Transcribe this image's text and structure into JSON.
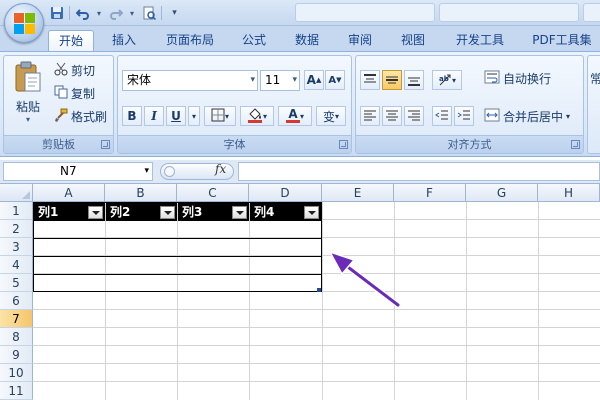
{
  "window": {
    "quick_access": [
      "save-icon",
      "undo-icon",
      "redo-icon",
      "print-preview-icon",
      "customize-icon"
    ]
  },
  "ribbon": {
    "tabs": [
      "开始",
      "插入",
      "页面布局",
      "公式",
      "数据",
      "审阅",
      "视图",
      "开发工具",
      "PDF工具集"
    ],
    "active_tab": "开始",
    "clipboard": {
      "paste": "粘贴",
      "cut": "剪切",
      "copy": "复制",
      "format_painter": "格式刷",
      "label": "剪贴板"
    },
    "font": {
      "name": "宋体",
      "size": "11",
      "grow": "A",
      "shrink": "A",
      "bold": "B",
      "italic": "I",
      "underline": "U",
      "font_color_letter": "A",
      "phonetic": "变",
      "label": "字体"
    },
    "alignment": {
      "wrap": "自动换行",
      "merge": "合并后居中",
      "label": "对齐方式"
    },
    "partial_next_group": "常"
  },
  "formula_bar": {
    "name_box": "N7",
    "fx": "fx",
    "value": ""
  },
  "sheet": {
    "columns": [
      "A",
      "B",
      "C",
      "D",
      "E",
      "F",
      "G",
      "H"
    ],
    "rows": [
      "1",
      "2",
      "3",
      "4",
      "5",
      "6",
      "7",
      "8",
      "9",
      "10",
      "11"
    ],
    "selected_row": "7",
    "table_headers": [
      "列1",
      "列2",
      "列3",
      "列4"
    ],
    "accent_colors": {
      "table_header_bg": "#000000",
      "arrow": "#6b2bb8",
      "selected_row": "#f6c56a"
    }
  }
}
